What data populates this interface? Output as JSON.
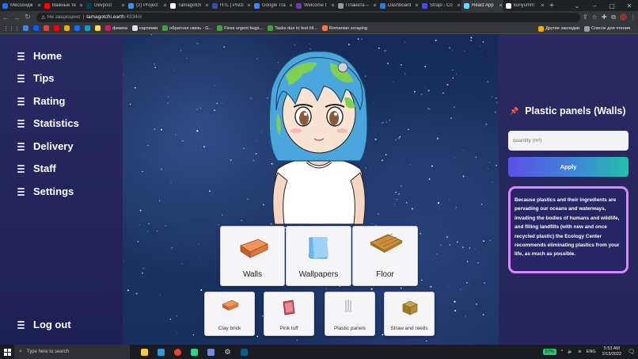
{
  "browser": {
    "tabs": [
      {
        "label": "Мессендж",
        "color": "#1a73e8"
      },
      {
        "label": "Важные те",
        "color": "#ff0000"
      },
      {
        "label": "Devpost",
        "color": "#003e54"
      },
      {
        "label": "(2) Project",
        "color": "#4a90e2"
      },
      {
        "label": "Tamagotch",
        "color": "#ffffff"
      },
      {
        "label": "HTL | Prezi",
        "color": "#3c4fa0"
      },
      {
        "label": "Google Tra",
        "color": "#4285f4"
      },
      {
        "label": "Welcome t",
        "color": "#6b3fa0"
      },
      {
        "label": "Планета –",
        "color": "#999999"
      },
      {
        "label": "Dashboard",
        "color": "#2b7bd9"
      },
      {
        "label": "Strapi - Co",
        "color": "#4945ff"
      },
      {
        "label": "React App",
        "color": "#61dafb",
        "active": true
      },
      {
        "label": "kuriyumm",
        "color": "#ffffff"
      }
    ],
    "address": {
      "warning": "Не защищено",
      "host": "tamagotchi.earth",
      "path": ":4334/#"
    },
    "bookmarks": [
      {
        "label": "",
        "color": "#4285f4"
      },
      {
        "label": "",
        "color": "#0061ff"
      },
      {
        "label": "",
        "color": "#ea4335"
      },
      {
        "label": "",
        "color": "#ff0000"
      },
      {
        "label": "",
        "color": "#f2a900"
      },
      {
        "label": "",
        "color": "#0d6efd"
      },
      {
        "label": "",
        "color": "#00a3e0"
      },
      {
        "label": "",
        "color": "#ffdb4d"
      },
      {
        "label": "физика",
        "color": "#d81b60"
      },
      {
        "label": "картинки",
        "color": "#e0e0e0"
      },
      {
        "label": "обратная связь - G...",
        "color": "#43a047"
      },
      {
        "label": "Fixes urgent bugs...",
        "color": "#43a047"
      },
      {
        "label": "Tasks due to test till...",
        "color": "#43a047"
      },
      {
        "label": "Romanian scraping",
        "color": "#ff7043"
      }
    ],
    "bookmarks_right": [
      "Другие закладки",
      "Список для чтения"
    ]
  },
  "sidebar": {
    "items": [
      {
        "label": "Home"
      },
      {
        "label": "Tips"
      },
      {
        "label": "Rating"
      },
      {
        "label": "Statistics"
      },
      {
        "label": "Delivery"
      },
      {
        "label": "Staff"
      },
      {
        "label": "Settings"
      }
    ],
    "logout": "Log out"
  },
  "categories": [
    {
      "label": "Walls",
      "icon": "brick-wall-icon"
    },
    {
      "label": "Wallpapers",
      "icon": "wallpaper-roll-icon"
    },
    {
      "label": "Floor",
      "icon": "parquet-floor-icon"
    }
  ],
  "materials": [
    {
      "label": "Clay brick",
      "icon": "clay-brick-icon"
    },
    {
      "label": "Pink tuff",
      "icon": "pink-tuff-icon"
    },
    {
      "label": "Plastic panels",
      "icon": "plastic-panels-icon"
    },
    {
      "label": "Straw and reeds",
      "icon": "straw-bale-icon"
    }
  ],
  "panel": {
    "title": "Plastic panels (Walls)",
    "quantity_placeholder": "quantity (m²)",
    "apply_label": "Apply",
    "fact": "Because plastics and their ingredients are pervading our oceans and waterways, invading the bodies of humans and wildlife, and filling landfills (with new and once recycled plastic) the Ecology Center recommends eliminating plastics from your life, as much as possible."
  },
  "taskbar": {
    "search_placeholder": "Type here to search",
    "battery": "57%",
    "lang": "ENG",
    "time": "5:53 AM",
    "date": "2/13/2022"
  },
  "colors": {
    "sidebar_bg": "#2a2b63",
    "fact_border": "#d58aff",
    "apply_gradient_start": "#5b4fe6",
    "apply_gradient_end": "#22c0a8"
  }
}
